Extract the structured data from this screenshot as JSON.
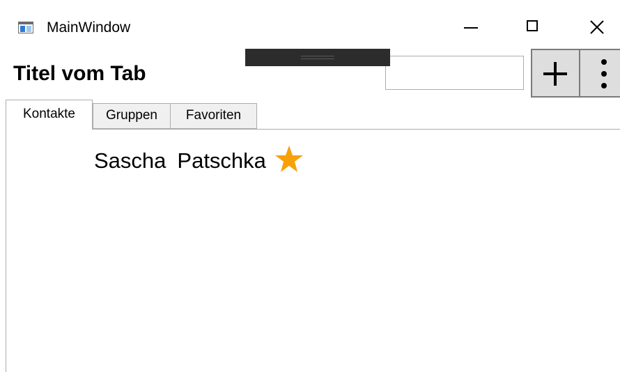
{
  "window": {
    "title": "MainWindow",
    "icon": "app-window-icon",
    "controls": [
      "minimize-icon",
      "maximize-icon",
      "close-icon"
    ]
  },
  "header": {
    "tab_title": "Titel vom Tab",
    "search": {
      "value": "",
      "placeholder": ""
    },
    "add_button_icon": "plus-icon",
    "more_button_icon": "vertical-ellipsis-icon"
  },
  "tabs": [
    {
      "label": "Kontakte",
      "selected": true
    },
    {
      "label": "Gruppen",
      "selected": false
    },
    {
      "label": "Favoriten",
      "selected": false
    }
  ],
  "contacts": [
    {
      "first_name": "Sascha",
      "last_name": "Patschka",
      "favorite": true,
      "favorite_icon": "star-icon"
    }
  ],
  "colors": {
    "star": "#f7a10a",
    "button_background": "#dedede",
    "tab_inactive": "#f0f0f0",
    "border": "#acacac",
    "drag_overlay": "#2c2c2c"
  }
}
